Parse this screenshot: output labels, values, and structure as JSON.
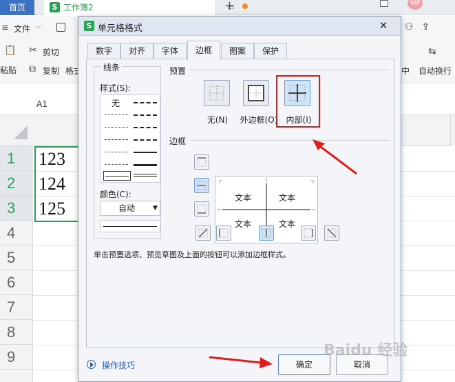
{
  "app": {
    "home_tab": "首页",
    "workbook_tab": "工作簿2",
    "logo_letter": "S",
    "menu": {
      "file": "文件"
    },
    "ribbon": {
      "paste": "粘贴",
      "cut": "剪切",
      "copy": "复制",
      "format_partial": "格式",
      "right_partial": "中",
      "wrap": "自动换行"
    },
    "name_box": "A1",
    "rows": [
      "1",
      "2",
      "3",
      "4",
      "5",
      "6",
      "7",
      "8",
      "9"
    ],
    "cells": [
      "123",
      "124",
      "125"
    ],
    "avatar": "WP"
  },
  "dialog": {
    "title": "单元格格式",
    "logo_letter": "S",
    "close_icon": "✕",
    "tabs": [
      "数字",
      "对齐",
      "字体",
      "边框",
      "图案",
      "保护"
    ],
    "active_tab": "边框",
    "line": {
      "title": "线条",
      "style_label": "样式(S):",
      "none_label": "无",
      "color_label": "颜色(C):",
      "color_value": "自动"
    },
    "preset": {
      "title": "预置",
      "options": [
        "无(N)",
        "外边框(O)",
        "内部(I)"
      ]
    },
    "border": {
      "title": "边框",
      "preview_text": [
        "文本",
        "文本",
        "文本",
        "文本"
      ]
    },
    "hint": "单击预置选项、预览草图及上面的按钮可以添加边框样式。",
    "tips_link": "操作技巧",
    "ok_label": "确定",
    "cancel_label": "取消"
  },
  "watermark": "Baidu 经验",
  "colors": {
    "accent_green": "#2aa253",
    "home_blue": "#3c72c4",
    "annotation_red": "#e01b1b"
  }
}
